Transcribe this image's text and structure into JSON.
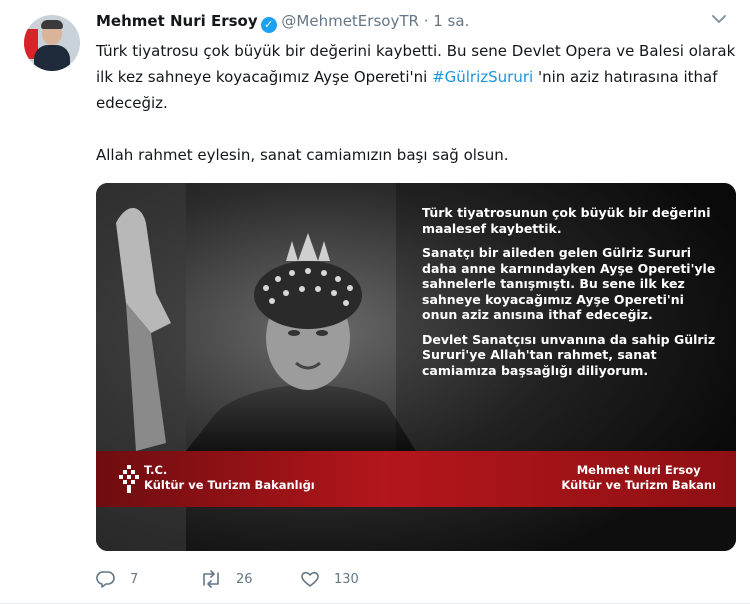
{
  "tweet": {
    "author_name": "Mehmet Nuri Ersoy",
    "handle": "@MehmetErsoyTR",
    "separator": "·",
    "time": "1 sa.",
    "text_line1_part1": "Türk tiyatrosu çok büyük bir değerini kaybetti. Bu sene Devlet Opera ve Balesi olarak ilk kez sahneye koyacağımız Ayşe Opereti'ni ",
    "hashtag": "#GülrizSururi",
    "text_line1_part2": " 'nin aziz hatırasına ithaf edeceğiz.",
    "text_line2": "Allah rahmet eylesin, sanat camiamızın başı sağ olsun."
  },
  "image": {
    "paragraph1": "Türk tiyatrosunun çok büyük bir değerini maalesef kaybettik.",
    "paragraph2": "Sanatçı bir aileden gelen Gülriz Sururi daha anne karnındayken Ayşe Opereti'yle sahnelerle tanışmıştı. Bu sene ilk kez sahneye koyacağımız Ayşe Opereti'ni onun aziz anısına ithaf edeceğiz.",
    "paragraph3": "Devlet Sanatçısı unvanına da sahip Gülriz Sururi'ye Allah'tan rahmet, sanat camiamıza başsağlığı diliyorum.",
    "ministry_line1": "T.C.",
    "ministry_line2": "Kültür ve Turizm Bakanlığı",
    "minister_name": "Mehmet Nuri Ersoy",
    "minister_title": "Kültür ve Turizm Bakanı"
  },
  "actions": {
    "replies": "7",
    "retweets": "26",
    "likes": "130"
  },
  "colors": {
    "accent": "#1da1f2",
    "hashtag": "#1b95e0",
    "banner_red": "#b3161b"
  }
}
